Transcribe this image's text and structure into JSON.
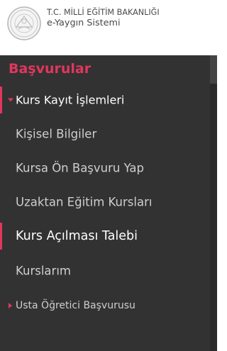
{
  "header": {
    "line1": "T.C. MİLLİ EĞİTİM BAKANLIĞI",
    "line2": "e-Yaygın Sistemi",
    "logo_icon": "meb-seal-icon"
  },
  "sidebar": {
    "section_title": "Başvurular",
    "items": [
      {
        "label": "Kurs Kayıt İşlemleri",
        "state": "expanded"
      },
      {
        "label": "Kişisel Bilgiler",
        "state": "normal"
      },
      {
        "label": "Kursa Ön Başvuru Yap",
        "state": "normal"
      },
      {
        "label": "Uzaktan Eğitim Kursları",
        "state": "normal"
      },
      {
        "label": "Kurs Açılması Talebi",
        "state": "active"
      },
      {
        "label": "Kurslarım",
        "state": "normal"
      },
      {
        "label": "Usta Öğretici Başvurusu",
        "state": "collapsed"
      }
    ]
  },
  "colors": {
    "accent": "#e2365d",
    "sidebar_bg": "#323232",
    "text_light": "#cfcfcf",
    "text_white": "#ffffff"
  }
}
